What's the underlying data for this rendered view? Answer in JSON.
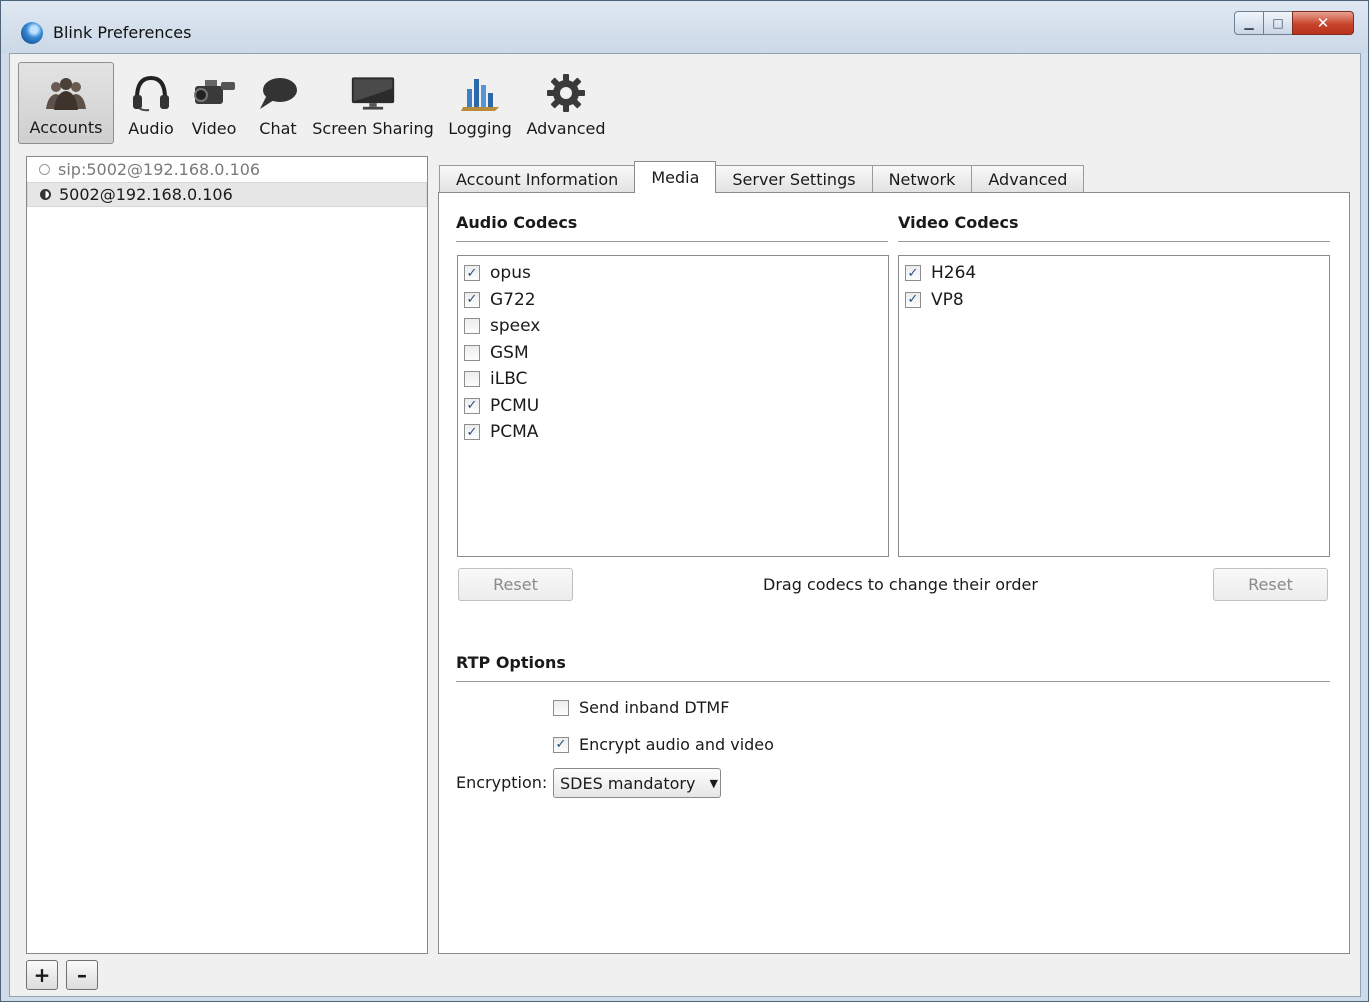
{
  "window": {
    "title": "Blink Preferences"
  },
  "toolbar": {
    "items": [
      {
        "label": "Accounts",
        "icon": "accounts-icon",
        "active": true
      },
      {
        "label": "Audio",
        "icon": "headset-icon"
      },
      {
        "label": "Video",
        "icon": "video-camera-icon"
      },
      {
        "label": "Chat",
        "icon": "chat-bubble-icon"
      },
      {
        "label": "Screen Sharing",
        "icon": "monitor-icon"
      },
      {
        "label": "Logging",
        "icon": "logging-chart-icon"
      },
      {
        "label": "Advanced",
        "icon": "gear-icon"
      }
    ]
  },
  "accounts": [
    {
      "label": "sip:5002@192.168.0.106",
      "state": "offline"
    },
    {
      "label": "5002@192.168.0.106",
      "state": "selected"
    }
  ],
  "bottom": {
    "add_label": "+",
    "remove_label": "–"
  },
  "tabs": [
    {
      "label": "Account Information"
    },
    {
      "label": "Media",
      "active": true
    },
    {
      "label": "Server Settings"
    },
    {
      "label": "Network"
    },
    {
      "label": "Advanced"
    }
  ],
  "media": {
    "audio_title": "Audio Codecs",
    "video_title": "Video Codecs",
    "audio_codecs": [
      {
        "name": "opus",
        "checked": true
      },
      {
        "name": "G722",
        "checked": true
      },
      {
        "name": "speex",
        "checked": false
      },
      {
        "name": "GSM",
        "checked": false
      },
      {
        "name": "iLBC",
        "checked": false
      },
      {
        "name": "PCMU",
        "checked": true
      },
      {
        "name": "PCMA",
        "checked": true
      }
    ],
    "video_codecs": [
      {
        "name": "H264",
        "checked": true
      },
      {
        "name": "VP8",
        "checked": true
      }
    ],
    "reset_label": "Reset",
    "drag_hint": "Drag codecs to change their order",
    "rtp_title": "RTP Options",
    "send_inband_dtmf": {
      "label": "Send inband DTMF",
      "checked": false
    },
    "encrypt_av": {
      "label": "Encrypt audio and video",
      "checked": true
    },
    "encryption_label": "Encryption:",
    "encryption_value": "SDES mandatory"
  },
  "colors": {
    "titlebar": "#cbd8e7",
    "close_button": "#c7452b",
    "check": "#2a4f7e"
  }
}
